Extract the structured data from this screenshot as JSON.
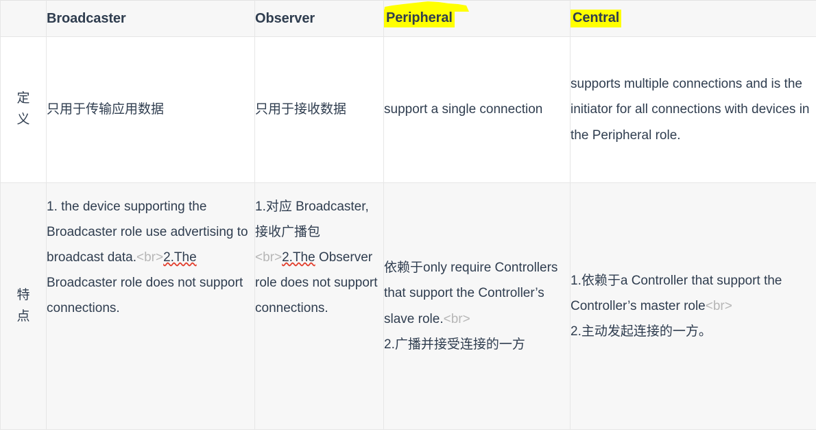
{
  "table": {
    "columns": [
      {
        "id": "rowlabel",
        "label": ""
      },
      {
        "id": "broadcaster",
        "label": "Broadcaster",
        "highlight": false
      },
      {
        "id": "observer",
        "label": "Observer",
        "highlight": false
      },
      {
        "id": "peripheral",
        "label": "Peripheral",
        "highlight": true
      },
      {
        "id": "central",
        "label": "Central",
        "highlight": true
      }
    ],
    "highlight_color": "#ffff00",
    "rows": [
      {
        "label": "定义",
        "broadcaster": "只用于传输应用数据",
        "observer": "只用于接收数据",
        "peripheral": "support a single connection",
        "central": "supports multiple connections and is the initiator for all connections with devices in the Peripheral role."
      },
      {
        "label": "特点",
        "broadcaster": {
          "part1": "1. the device supporting the Broadcaster role use advertising to broadcast data.",
          "brtag1": "<br>",
          "misspelled": "2.The",
          "part2": " Broadcaster role does not support connections."
        },
        "observer": {
          "part1": "1.对应 Broadcaster, 接收广播包 ",
          "brtag1": "<br>",
          "misspelled": "2.The",
          "part2": " Observer role does not support connections."
        },
        "peripheral": {
          "part1": "依赖于only require Controllers that support the Controller’s slave role.",
          "brtag1": "<br>",
          "part2": "2.广播并接受连接的一方"
        },
        "central": {
          "part1": "1.依赖于a Controller that support the Controller’s master role",
          "brtag1": "<br>",
          "part2": "2.主动发起连接的一方。"
        }
      }
    ]
  }
}
